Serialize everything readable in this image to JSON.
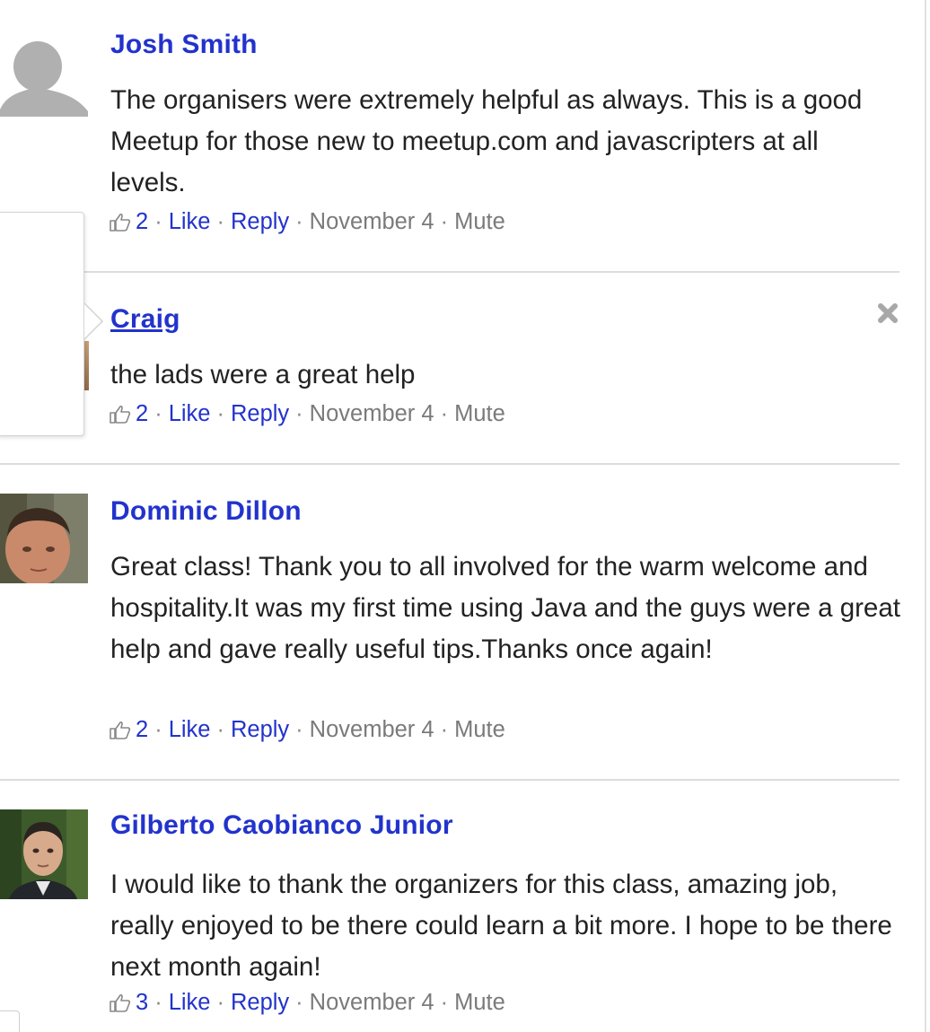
{
  "comments": [
    {
      "author": "Josh Smith",
      "body": "The organisers were extremely helpful as always. This is a good Meetup for those new to meetup.com and javascripters at all levels.",
      "likes": "2",
      "like_label": "Like",
      "reply_label": "Reply",
      "date": "November 4",
      "mute_label": "Mute",
      "avatar": "placeholder-silhouette"
    },
    {
      "author": "Craig",
      "body": "the lads were a great help",
      "likes": "2",
      "like_label": "Like",
      "reply_label": "Reply",
      "date": "November 4",
      "mute_label": "Mute",
      "avatar": "photo"
    },
    {
      "author": "Dominic Dillon",
      "body": "Great class! Thank you to all involved for the warm welcome and hospitality.It was my first time using Java and the guys were a great help and gave really useful tips.Thanks once again!",
      "likes": "2",
      "like_label": "Like",
      "reply_label": "Reply",
      "date": "November 4",
      "mute_label": "Mute",
      "avatar": "photo"
    },
    {
      "author": "Gilberto Caobianco Junior",
      "body": "I would like to thank the organizers for this class, amazing job, really enjoyed to be there could learn a bit more. I hope to be there next month again!",
      "likes": "3",
      "like_label": "Like",
      "reply_label": "Reply",
      "date": "November 4",
      "mute_label": "Mute",
      "avatar": "photo"
    }
  ],
  "separator": "·",
  "icons": {
    "like": "thumbs-up-icon",
    "delete": "close-icon"
  },
  "colors": {
    "link": "#2233cc",
    "meta": "#7a7a7a",
    "divider": "#dcdcdc",
    "text": "#222222"
  }
}
